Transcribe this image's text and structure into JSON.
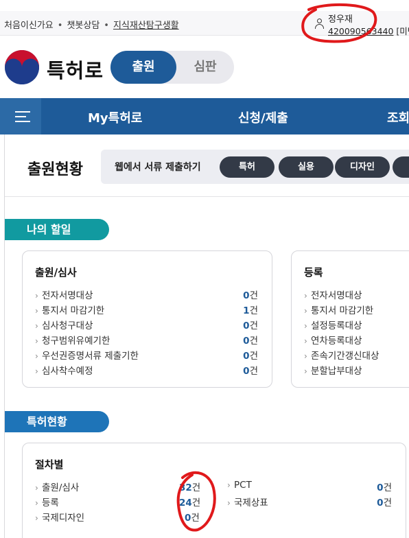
{
  "topbar": {
    "links": [
      "처음이신가요",
      "챗봇상담",
      "지식재산탐구생활"
    ],
    "user_name": "정우재",
    "user_id": "420090563440",
    "user_suffix": "[미반"
  },
  "brand": {
    "name": "특허로"
  },
  "mode_toggle": {
    "active": "출원",
    "inactive": "심판"
  },
  "nav": {
    "items": [
      "My특허로",
      "신청/제출",
      "조회"
    ]
  },
  "main": {
    "title": "출원현황",
    "web_submit_label": "웹에서 서류 제출하기",
    "web_submit_buttons": [
      "특허",
      "실용",
      "디자인"
    ]
  },
  "todo": {
    "tag": "나의 할일",
    "exam_card": {
      "title": "출원/심사",
      "unit": "건",
      "rows": [
        {
          "label": "전자서명대상",
          "count": "0"
        },
        {
          "label": "통지서 마감기한",
          "count": "1"
        },
        {
          "label": "심사청구대상",
          "count": "0"
        },
        {
          "label": "청구범위유예기한",
          "count": "0"
        },
        {
          "label": "우선권증명서류 제출기한",
          "count": "0"
        },
        {
          "label": "심사착수예정",
          "count": "0"
        }
      ]
    },
    "reg_card": {
      "title": "등록",
      "rows": [
        {
          "label": "전자서명대상"
        },
        {
          "label": "통지서 마감기한"
        },
        {
          "label": "설정등록대상"
        },
        {
          "label": "연차등록대상"
        },
        {
          "label": "존속기간갱신대상"
        },
        {
          "label": "분할납부대상"
        }
      ]
    }
  },
  "patent_status": {
    "tag": "특허현황",
    "card_title": "절차별",
    "unit": "건",
    "left_rows": [
      {
        "label": "출원/심사",
        "count": "32"
      },
      {
        "label": "등록",
        "count": "24"
      },
      {
        "label": "국제디자인",
        "count": "0"
      }
    ],
    "right_rows": [
      {
        "label": "PCT",
        "count": "0"
      },
      {
        "label": "국제상표",
        "count": "0"
      }
    ]
  },
  "colors": {
    "primary": "#1e5b99",
    "teal": "#119aa0",
    "annotation": "#e0191b"
  }
}
